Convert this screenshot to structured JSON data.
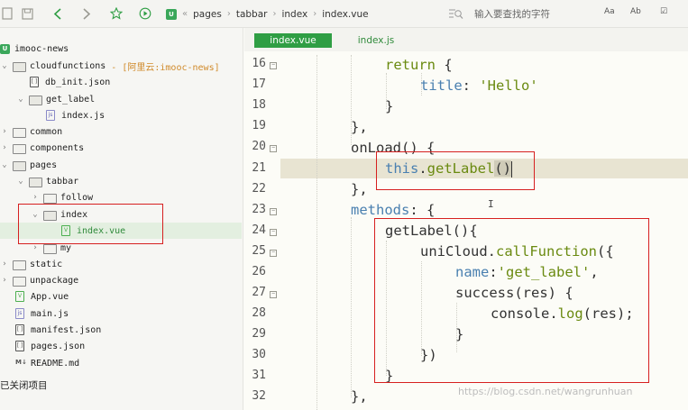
{
  "toolbar": {
    "icons": [
      "file-icon",
      "save-icon",
      "back-icon",
      "forward-icon",
      "favorite-icon",
      "run-icon"
    ],
    "breadcrumb_badge": "U",
    "breadcrumb": [
      "pages",
      "tabbar",
      "index",
      "index.vue"
    ],
    "search_placeholder": "输入要查找的字符",
    "search_options": [
      "Aa",
      "Ab",
      "☑"
    ]
  },
  "sidebar": {
    "project": "imooc-news",
    "items": [
      {
        "label": "cloudfunctions",
        "hint": "- [阿里云:imooc-news]",
        "type": "folder",
        "state": "open"
      },
      {
        "label": "db_init.json",
        "type": "json"
      },
      {
        "label": "get_label",
        "type": "folder",
        "state": "open"
      },
      {
        "label": "index.js",
        "type": "js"
      },
      {
        "label": "common",
        "type": "folder",
        "state": "closed"
      },
      {
        "label": "components",
        "type": "folder",
        "state": "closed"
      },
      {
        "label": "pages",
        "type": "folder",
        "state": "open"
      },
      {
        "label": "tabbar",
        "type": "folder",
        "state": "open"
      },
      {
        "label": "follow",
        "type": "folder",
        "state": "closed"
      },
      {
        "label": "index",
        "type": "folder",
        "state": "open"
      },
      {
        "label": "index.vue",
        "type": "vue",
        "selected": true
      },
      {
        "label": "my",
        "type": "folder",
        "state": "closed"
      },
      {
        "label": "static",
        "type": "folder",
        "state": "closed"
      },
      {
        "label": "unpackage",
        "type": "folder",
        "state": "closed"
      },
      {
        "label": "App.vue",
        "type": "vue"
      },
      {
        "label": "main.js",
        "type": "js"
      },
      {
        "label": "manifest.json",
        "type": "json"
      },
      {
        "label": "pages.json",
        "type": "json"
      },
      {
        "label": "README.md",
        "type": "md"
      }
    ],
    "closed_projects": "已关闭项目"
  },
  "editor": {
    "tabs": [
      "index.vue",
      "index.js"
    ],
    "line_numbers": [
      "16",
      "17",
      "18",
      "19",
      "20",
      "21",
      "22",
      "23",
      "24",
      "25",
      "26",
      "27",
      "28",
      "29",
      "30",
      "31",
      "32"
    ],
    "lines": {
      "l16_kw": "return",
      "l16_rest": " {",
      "l17_prop": "title",
      "l17_colon": ": ",
      "l17_str": "'Hello'",
      "l18": "}",
      "l19": "},",
      "l20": "onLoad() {",
      "l21_this": "this",
      "l21_dot": ".",
      "l21_fn": "getLabel",
      "l21_open": "(",
      "l21_close": ")",
      "l22": "},",
      "l23_prop": "methods",
      "l23_rest": ": {",
      "l24": "getLabel(){",
      "l25_obj": "uniCloud.",
      "l25_fn": "callFunction",
      "l25_rest": "({",
      "l26_prop": "name",
      "l26_colon": ":",
      "l26_str": "'get_label'",
      "l26_rest": ",",
      "l27": "success(res) {",
      "l28_obj": "console.",
      "l28_fn": "log",
      "l28_rest": "(res);",
      "l29": "}",
      "l30": "})",
      "l31": "}",
      "l32": "},"
    },
    "mouse_cursor": "I",
    "watermark": "https://blog.csdn.net/wangrunhuan"
  }
}
